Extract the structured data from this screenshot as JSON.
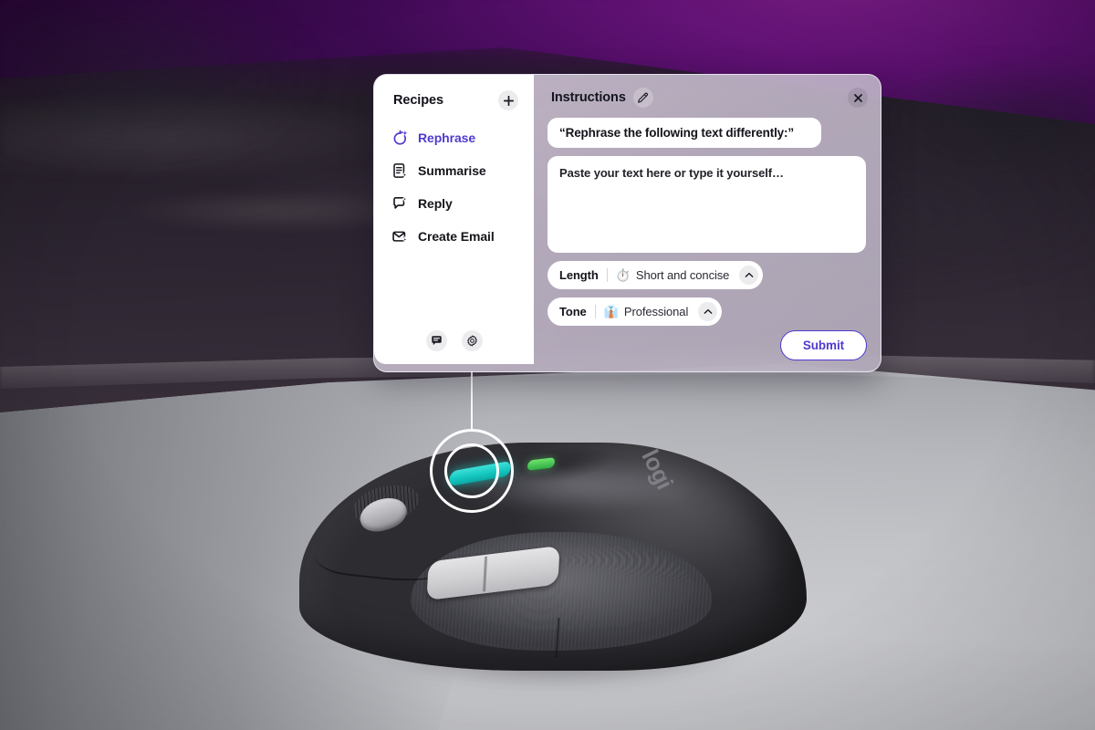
{
  "background": {
    "scene_description": "logitech-mouse-on-desk",
    "wall_color": "#5c1070",
    "desk_color": "#2b2430",
    "pad_color": "#c2c3c7"
  },
  "device": {
    "brand_label": "logi",
    "ai_button_color": "#14c8c0",
    "led_button_color": "#2fae44"
  },
  "callout": {
    "ring_color": "#ffffff"
  },
  "panel": {
    "accent_color": "#4f3bcf",
    "sidebar": {
      "title": "Recipes",
      "add_button_name": "add-recipe",
      "items": [
        {
          "label": "Rephrase",
          "icon": "rephrase-sparkle-icon",
          "active": true
        },
        {
          "label": "Summarise",
          "icon": "document-sparkle-icon",
          "active": false
        },
        {
          "label": "Reply",
          "icon": "reply-sparkle-icon",
          "active": false
        },
        {
          "label": "Create Email",
          "icon": "envelope-sparkle-icon",
          "active": false
        }
      ],
      "footer_icons": [
        {
          "name": "feedback-icon"
        },
        {
          "name": "gear-icon"
        }
      ]
    },
    "content": {
      "title": "Instructions",
      "edit_icon": "pencil-icon",
      "close_icon": "close-icon",
      "prompt_value": "“Rephrase the following text differently:”",
      "textarea_placeholder": "Paste your text here or type it yourself…",
      "textarea_value": "",
      "options": [
        {
          "label": "Length",
          "emoji": "⏱️",
          "emoji_name": "stopwatch-icon",
          "value": "Short and concise",
          "chevron": "chevron-up-icon"
        },
        {
          "label": "Tone",
          "emoji": "👔",
          "emoji_name": "necktie-professional-icon",
          "value": "Professional",
          "chevron": "chevron-up-icon"
        }
      ],
      "submit_label": "Submit"
    }
  }
}
